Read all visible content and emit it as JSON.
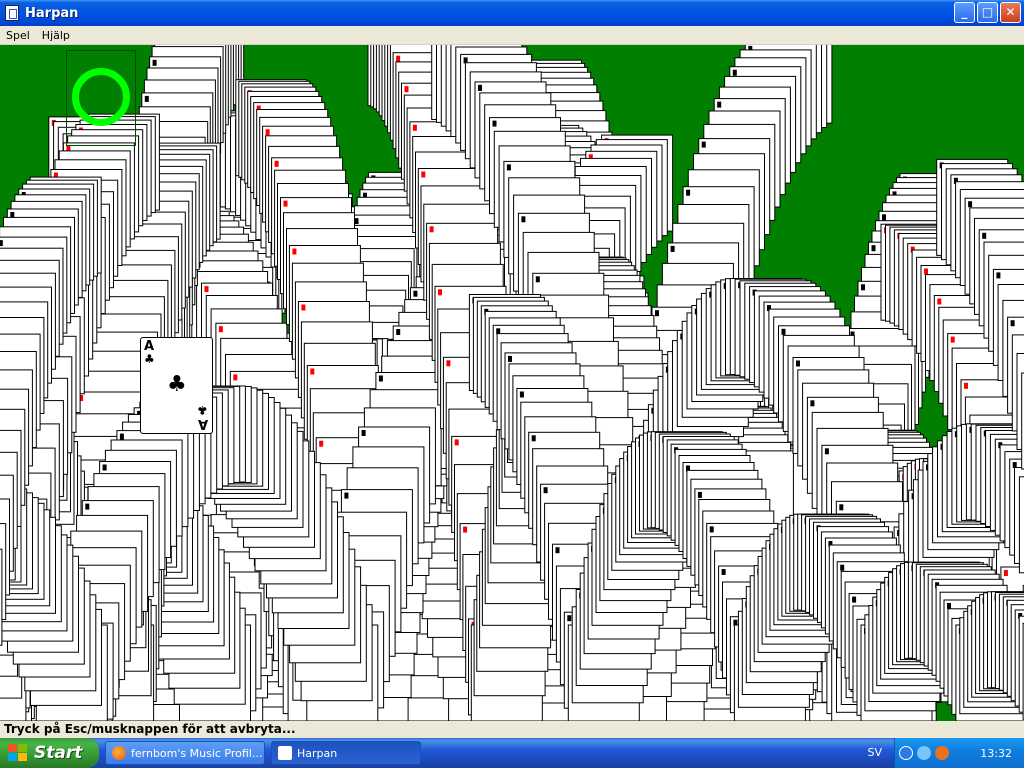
{
  "window": {
    "title": "Harpan",
    "minimize_glyph": "_",
    "maximize_glyph": "□",
    "close_glyph": "✕"
  },
  "menu": {
    "items": [
      {
        "label": "Spel"
      },
      {
        "label": "Hjälp"
      }
    ]
  },
  "game": {
    "ace_card": {
      "rank": "A",
      "suit": "♣"
    },
    "card_back_color": "#ffffff",
    "felt_color": "#007f00",
    "stock_ring_color": "#00ff00",
    "red_suit_color": "#ff0000"
  },
  "status": {
    "text": "Tryck på Esc/musknappen för att avbryta..."
  },
  "taskbar": {
    "start_label": "Start",
    "tasks": [
      {
        "label": "fernbom's Music Profil...",
        "icon": "firefox-icon"
      },
      {
        "label": "Harpan",
        "icon": "solitaire-icon"
      }
    ],
    "language": "SV",
    "clock": "13:32"
  }
}
